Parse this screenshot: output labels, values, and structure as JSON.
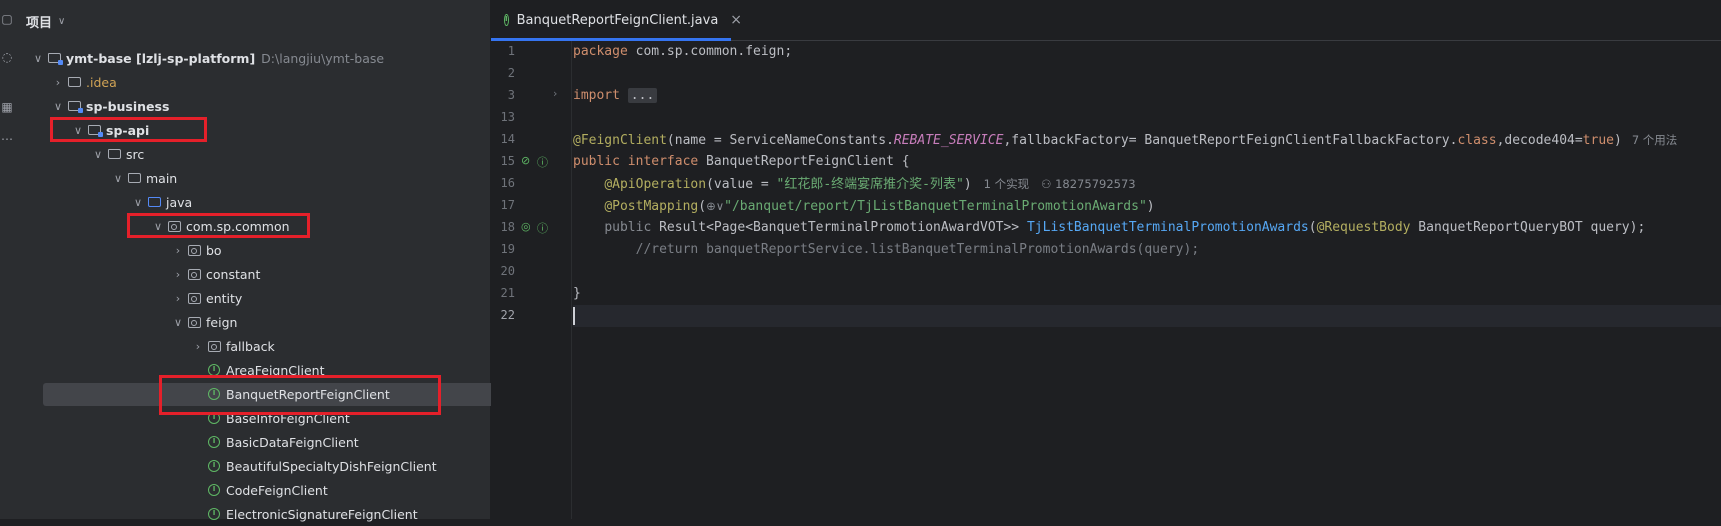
{
  "project_panel": {
    "title": "项目",
    "tree": [
      {
        "label": "ymt-base [lzlj-sp-platform]",
        "hint": "D:\\langjiu\\ymt-base"
      },
      {
        "label": ".idea"
      },
      {
        "label": "sp-business"
      },
      {
        "label": "sp-api"
      },
      {
        "label": "src"
      },
      {
        "label": "main"
      },
      {
        "label": "java"
      },
      {
        "label": "com.sp.common"
      },
      {
        "label": "bo"
      },
      {
        "label": "constant"
      },
      {
        "label": "entity"
      },
      {
        "label": "feign"
      },
      {
        "label": "fallback"
      },
      {
        "label": "AreaFeignClient"
      },
      {
        "label": "BanquetReportFeignClient"
      },
      {
        "label": "BaseInfoFeignClient"
      },
      {
        "label": "BasicDataFeignClient"
      },
      {
        "label": "BeautifulSpecialtyDishFeignClient"
      },
      {
        "label": "CodeFeignClient"
      },
      {
        "label": "ElectronicSignatureFeignClient"
      }
    ]
  },
  "editor": {
    "tab_label": "BanquetReportFeignClient.java",
    "tab_close": "×",
    "line_numbers": [
      "1",
      "2",
      "3",
      "13",
      "14",
      "15",
      "16",
      "17",
      "18",
      "19",
      "20",
      "21",
      "22"
    ],
    "code": {
      "l1_kw": "package",
      "l1_rest": " com.sp.common.feign;",
      "l3_kw": "import",
      "l3_fold": "...",
      "l14_ann": "@FeignClient",
      "l14_a": "(name = ServiceNameConstants.",
      "l14_const": "REBATE_SERVICE",
      "l14_b": ",fallbackFactory= BanquetReportFeignClientFallbackFactory.",
      "l14_class": "class",
      "l14_c": ",decode404=",
      "l14_true": "true",
      "l14_d": ")",
      "l14_hint": "7 个用法",
      "l15_kw": "public interface",
      "l15_rest": " BanquetReportFeignClient {",
      "l16_ann": "@ApiOperation",
      "l16_a": "(value = ",
      "l16_str": "\"红花郎-终端宴席推介奖-列表\"",
      "l16_b": ")",
      "l16_hint1": "1 个实现",
      "l16_hint2": "18275792573",
      "l17_ann": "@PostMapping",
      "l17_a": "(",
      "l17_globe": "⊕∨",
      "l17_str": "\"/banquet/report/TjListBanquetTerminalPromotionAwards\"",
      "l17_b": ")",
      "l18_kw": "public",
      "l18_a": " Result<Page<BanquetTerminalPromotionAwardVOT>> ",
      "l18_fn": "TjListBanquetTerminalPromotionAwards",
      "l18_b": "(",
      "l18_ann": "@RequestBody",
      "l18_c": " BanquetReportQueryBOT query);",
      "l19_cm": "//return banquetReportService.listBanquetTerminalPromotionAwards(query);",
      "l21": "}"
    }
  },
  "colors": {
    "keyword": "#cf8e6d",
    "annotation": "#b3ae60",
    "string": "#6aab73",
    "highlight_box": "#e5202a",
    "tab_accent": "#3574f0"
  }
}
